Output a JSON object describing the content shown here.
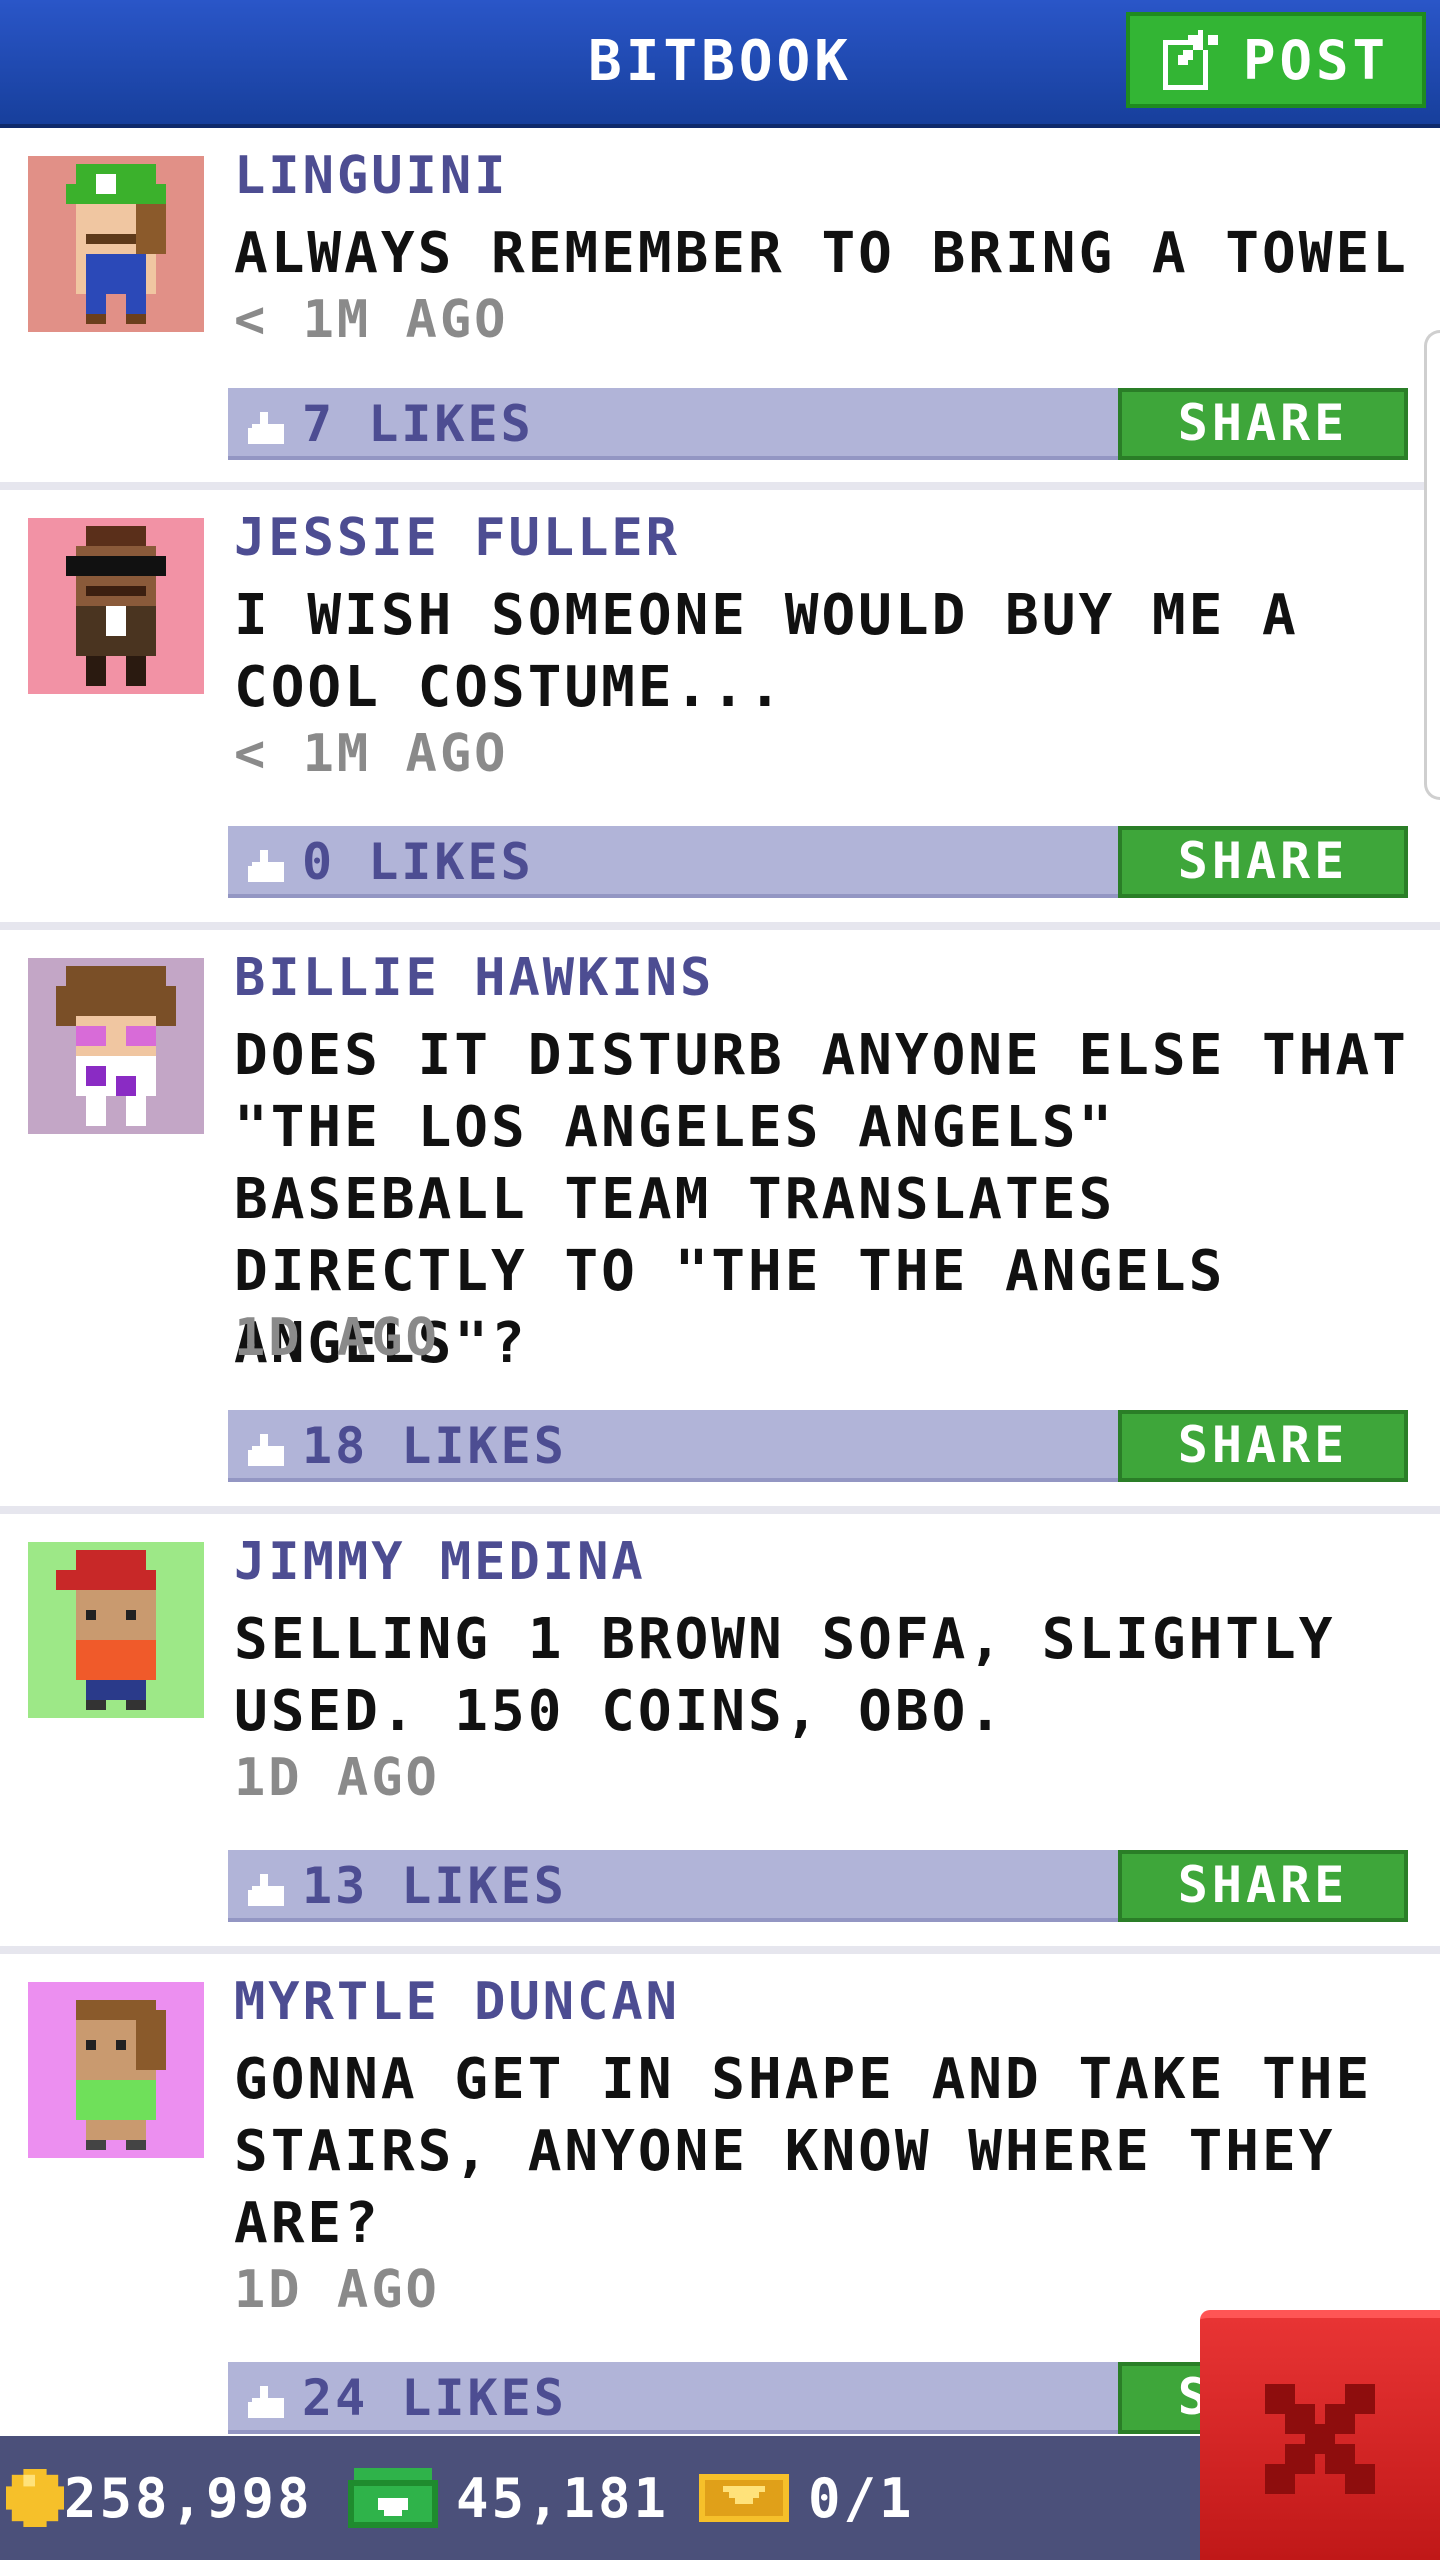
{
  "header": {
    "title": "BITBOOK",
    "post_label": "POST"
  },
  "posts": [
    {
      "name": "LINGUINI",
      "message": "ALWAYS REMEMBER TO BRING A TOWEL",
      "time": "< 1M AGO",
      "likes": "7 LIKES",
      "share": "SHARE",
      "avatar_bg": "#e19087"
    },
    {
      "name": "JESSIE FULLER",
      "message": "I WISH SOMEONE WOULD BUY ME A COOL COSTUME...",
      "time": "< 1M AGO",
      "likes": "0 LIKES",
      "share": "SHARE",
      "avatar_bg": "#f292a5"
    },
    {
      "name": "BILLIE HAWKINS",
      "message": "DOES IT DISTURB ANYONE ELSE THAT \"THE LOS ANGELES ANGELS\" BASEBALL TEAM TRANSLATES DIRECTLY TO \"THE THE ANGELS ANGELS\"?",
      "time": "1D AGO",
      "likes": "18 LIKES",
      "share": "SHARE",
      "avatar_bg": "#c3a6c6"
    },
    {
      "name": "JIMMY MEDINA",
      "message": "SELLING 1 BROWN SOFA, SLIGHTLY USED. 150 COINS, OBO.",
      "time": "1D AGO",
      "likes": "13 LIKES",
      "share": "SHARE",
      "avatar_bg": "#9de887"
    },
    {
      "name": "MYRTLE DUNCAN",
      "message": "GONNA GET IN SHAPE AND TAKE THE STAIRS, ANYONE KNOW WHERE THEY ARE?",
      "time": "1D AGO",
      "likes": "24 LIKES",
      "share": "SHARE",
      "avatar_bg": "#ec8ff0"
    }
  ],
  "footer": {
    "coins": "258,998",
    "bux": "45,181",
    "tickets": "0/1"
  },
  "colors": {
    "header": "#1f4fc0",
    "post_button": "#33b534",
    "share_button": "#3ea63a",
    "likes_bar": "#b1b4d8",
    "name_text": "#4d4d92",
    "footer": "#4b507a",
    "close_button": "#d92222"
  },
  "icons": {
    "post": "edit-icon",
    "like": "thumbs-up-icon",
    "coin": "coin-icon",
    "bux": "bux-icon",
    "ticket": "ticket-icon",
    "close": "close-icon"
  }
}
